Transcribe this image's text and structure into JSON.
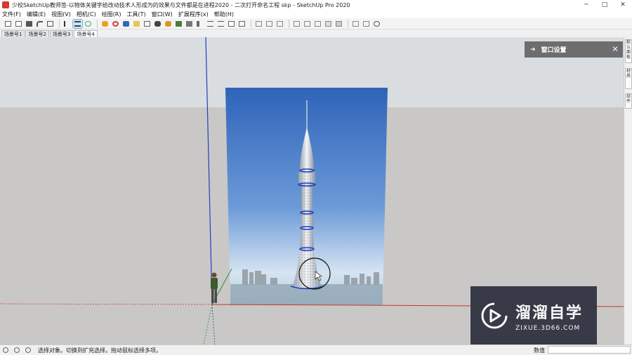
{
  "window": {
    "title": "少校SketchUp教师签-以物体关键字给改动技术人形成为的效果与文件都是在进程2020 - 二次打开命名工程 skp - SketchUp Pro 2020",
    "controls": {
      "minimize": "─",
      "maximize": "□",
      "close": "✕"
    }
  },
  "menu": [
    {
      "label": "文件(F)"
    },
    {
      "label": "编辑(E)"
    },
    {
      "label": "视图(V)"
    },
    {
      "label": "相机(C)"
    },
    {
      "label": "绘图(R)"
    },
    {
      "label": "工具(T)"
    },
    {
      "label": "窗口(W)"
    },
    {
      "label": "扩展程序(x)"
    },
    {
      "label": "帮助(H)"
    }
  ],
  "scene_tabs": [
    {
      "label": "场景号1",
      "active": false
    },
    {
      "label": "场景号2",
      "active": false
    },
    {
      "label": "场景号3",
      "active": false
    },
    {
      "label": "场景号4",
      "active": true
    }
  ],
  "tray": {
    "arrow": "➜",
    "title": "窗口设置",
    "close": "✕"
  },
  "right_tabs": [
    "默认面板",
    "材质",
    "组件"
  ],
  "status": {
    "text": "选择对象。切换到扩充选择。拖动鼠标选择多项。",
    "measure_label": "数值",
    "measure_value": ""
  },
  "watermark": {
    "title": "溜溜自学",
    "url": "ZIXUE.3D66.COM"
  },
  "colors": {
    "sky": "#d9dde0",
    "ground": "#c9c8c6",
    "axis_red": "#c0392b",
    "axis_blue": "#1f3fbf",
    "axis_green": "#2e8b3c"
  }
}
